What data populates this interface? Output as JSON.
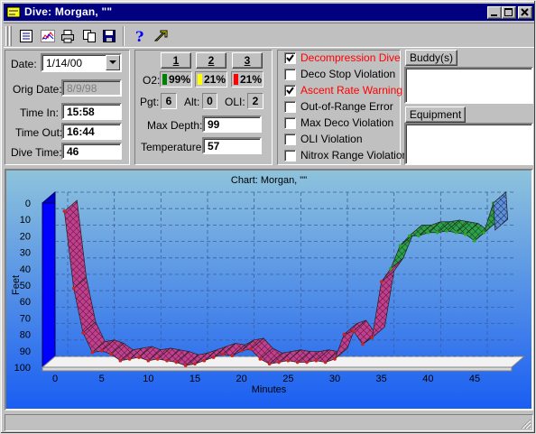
{
  "window": {
    "title": "Dive: Morgan, \"\""
  },
  "toolbar": {
    "icons": [
      "log-book-icon",
      "chart-icon",
      "print-icon",
      "copy-icon",
      "save-icon",
      "help-icon",
      "context-help-icon"
    ]
  },
  "dive": {
    "date_label": "Date:",
    "date_value": "1/14/00",
    "orig_date_label": "Orig Date:",
    "orig_date_value": "8/9/98",
    "time_in_label": "Time In:",
    "time_in_value": "15:58",
    "time_out_label": "Time Out:",
    "time_out_value": "16:44",
    "dive_time_label": "Dive Time:",
    "dive_time_value": "46"
  },
  "gas": {
    "mix_buttons": [
      "1",
      "2",
      "3"
    ],
    "o2_label": "O2:",
    "o2_values": [
      "99%",
      "21%",
      "21%"
    ],
    "o2_colors": [
      "#008000",
      "#ffff00",
      "#ff0000"
    ],
    "pgt_label": "Pgt:",
    "pgt_value": "6",
    "alt_label": "Alt:",
    "alt_value": "0",
    "oli_label": "OLI:",
    "oli_value": "2",
    "max_depth_label": "Max Depth:",
    "max_depth_value": "99",
    "temperature_label": "Temperature:",
    "temperature_value": "57"
  },
  "warnings": [
    {
      "label": "Decompression Dive",
      "checked": true,
      "red": true
    },
    {
      "label": "Deco Stop Violation",
      "checked": false,
      "red": false
    },
    {
      "label": "Ascent Rate Warning",
      "checked": true,
      "red": true
    },
    {
      "label": "Out-of-Range Error",
      "checked": false,
      "red": false
    },
    {
      "label": "Max Deco Violation",
      "checked": false,
      "red": false
    },
    {
      "label": "OLI Violation",
      "checked": false,
      "red": false
    },
    {
      "label": "Nitrox Range Violation",
      "checked": false,
      "red": false
    }
  ],
  "side": {
    "buddy_label": "Buddy(s)",
    "equipment_label": "Equipment"
  },
  "chart_data": {
    "type": "line",
    "title": "Chart: Morgan, \"\"",
    "xlabel": "Minutes",
    "ylabel": "Feet",
    "xlim": [
      0,
      48
    ],
    "ylim": [
      0,
      100
    ],
    "y_inverted": true,
    "xticks": [
      0,
      5,
      10,
      15,
      20,
      25,
      30,
      35,
      40,
      45
    ],
    "yticks": [
      0,
      10,
      20,
      30,
      40,
      50,
      60,
      70,
      80,
      90,
      100
    ],
    "series": [
      {
        "color": "#cc2222",
        "x": [
          1,
          2,
          3,
          4,
          5,
          6,
          7,
          8,
          9,
          10,
          11,
          12,
          13,
          14,
          15,
          16,
          17,
          18,
          19,
          20,
          21,
          22,
          23,
          24,
          25,
          26,
          27,
          28,
          29,
          30,
          31,
          32,
          33,
          34,
          35,
          36
        ],
        "y": [
          5,
          52,
          79,
          91,
          90,
          92,
          96,
          95,
          94,
          96,
          95,
          96,
          97,
          99,
          98,
          96,
          94,
          92,
          93,
          90,
          89,
          95,
          98,
          97,
          96,
          97,
          97,
          96,
          97,
          95,
          80,
          78,
          86,
          82,
          48,
          40
        ]
      },
      {
        "color": "#22aa22",
        "x": [
          36,
          37,
          38,
          39,
          40,
          41,
          42,
          43,
          44,
          45,
          46,
          47
        ],
        "y": [
          40,
          26,
          20,
          20,
          18,
          18,
          17,
          18,
          19,
          23,
          18,
          0
        ]
      }
    ]
  }
}
